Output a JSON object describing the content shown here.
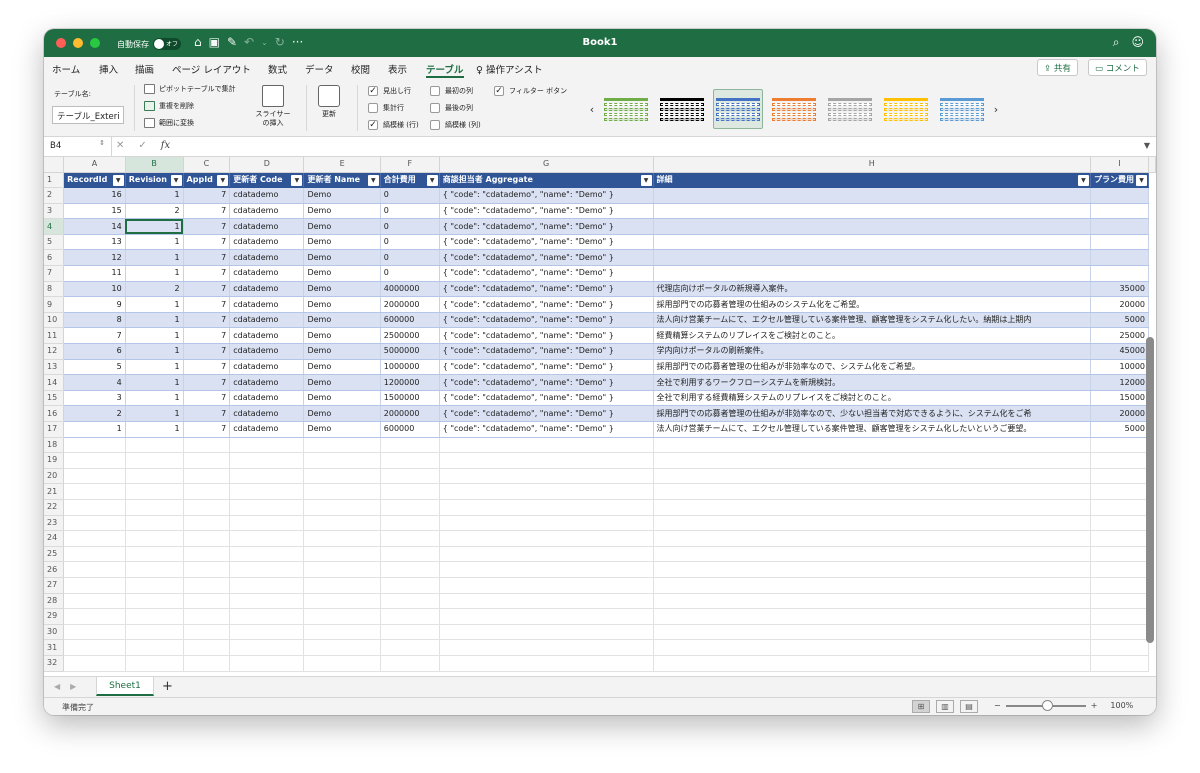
{
  "window": {
    "title": "Book1",
    "autosave_label": "自動保存",
    "autosave_state": "オフ",
    "more": "···"
  },
  "menu": {
    "tabs": [
      "ホーム",
      "挿入",
      "描画",
      "ページ レイアウト",
      "数式",
      "データ",
      "校閲",
      "表示",
      "テーブル",
      "操作アシスト"
    ],
    "active": "テーブル",
    "share": "共有",
    "comment": "コメント"
  },
  "ribbon": {
    "table_name_label": "テーブル名:",
    "table_name_value": "テーブル_Exteri",
    "pivot": "ピボットテーブルで集計",
    "dedupe": "重複を削除",
    "convert": "範囲に変換",
    "slicer": [
      "スライサー",
      "の挿入"
    ],
    "refresh": "更新",
    "header_row": "見出し行",
    "total_row": "集計行",
    "banded_rows": "縞模様 (行)",
    "first_col": "最初の列",
    "last_col": "最後の列",
    "banded_cols": "縞模様 (列)",
    "filter_btn": "フィルター ボタン",
    "style_colors": [
      "#70ad47",
      "#000000",
      "#4472c4",
      "#ed7d31",
      "#a5a5a5",
      "#ffc000",
      "#5b9bd5"
    ],
    "style_selected": 2
  },
  "formula_bar": {
    "name_box": "B4",
    "fx": "fx",
    "content": ""
  },
  "columns": [
    "A",
    "B",
    "C",
    "D",
    "E",
    "F",
    "G",
    "H",
    "I"
  ],
  "selected_col": "B",
  "selected_row": 4,
  "table_headers": [
    "RecordId",
    "Revision",
    "AppId",
    "更新者 Code",
    "更新者 Name",
    "合計費用",
    "商談担当者 Aggregate",
    "詳細",
    "プラン費用"
  ],
  "rows": [
    [
      "16",
      "1",
      "7",
      "cdatademo",
      "Demo",
      "0",
      "{   \"code\": \"cdatademo\",    \"name\": \"Demo\"  }",
      "",
      ""
    ],
    [
      "15",
      "2",
      "7",
      "cdatademo",
      "Demo",
      "0",
      "{   \"code\": \"cdatademo\",    \"name\": \"Demo\"  }",
      "",
      ""
    ],
    [
      "14",
      "1",
      "7",
      "cdatademo",
      "Demo",
      "0",
      "{   \"code\": \"cdatademo\",    \"name\": \"Demo\"  }",
      "",
      ""
    ],
    [
      "13",
      "1",
      "7",
      "cdatademo",
      "Demo",
      "0",
      "{   \"code\": \"cdatademo\",    \"name\": \"Demo\"  }",
      "",
      ""
    ],
    [
      "12",
      "1",
      "7",
      "cdatademo",
      "Demo",
      "0",
      "{   \"code\": \"cdatademo\",    \"name\": \"Demo\"  }",
      "",
      ""
    ],
    [
      "11",
      "1",
      "7",
      "cdatademo",
      "Demo",
      "0",
      "{   \"code\": \"cdatademo\",    \"name\": \"Demo\"  }",
      "",
      ""
    ],
    [
      "10",
      "2",
      "7",
      "cdatademo",
      "Demo",
      "4000000",
      "{   \"code\": \"cdatademo\",    \"name\": \"Demo\"  }",
      "代理店向けポータルの新規導入案件。",
      "35000"
    ],
    [
      "9",
      "1",
      "7",
      "cdatademo",
      "Demo",
      "2000000",
      "{   \"code\": \"cdatademo\",    \"name\": \"Demo\"  }",
      "採用部門での応募者管理の仕組みのシステム化をご希望。",
      "20000"
    ],
    [
      "8",
      "1",
      "7",
      "cdatademo",
      "Demo",
      "600000",
      "{   \"code\": \"cdatademo\",    \"name\": \"Demo\"  }",
      "法人向け営業チームにて、エクセル管理している案件管理、顧客管理をシステム化したい。納期は上期内",
      "5000"
    ],
    [
      "7",
      "1",
      "7",
      "cdatademo",
      "Demo",
      "2500000",
      "{   \"code\": \"cdatademo\",    \"name\": \"Demo\"  }",
      "経費精算システムのリプレイスをご検討とのこと。",
      "25000"
    ],
    [
      "6",
      "1",
      "7",
      "cdatademo",
      "Demo",
      "5000000",
      "{   \"code\": \"cdatademo\",    \"name\": \"Demo\"  }",
      "学内向けポータルの刷新案件。",
      "45000"
    ],
    [
      "5",
      "1",
      "7",
      "cdatademo",
      "Demo",
      "1000000",
      "{   \"code\": \"cdatademo\",    \"name\": \"Demo\"  }",
      "採用部門での応募者管理の仕組みが非効率なので、システム化をご希望。",
      "10000"
    ],
    [
      "4",
      "1",
      "7",
      "cdatademo",
      "Demo",
      "1200000",
      "{   \"code\": \"cdatademo\",    \"name\": \"Demo\"  }",
      "全社で利用するワークフローシステムを新規検討。",
      "12000"
    ],
    [
      "3",
      "1",
      "7",
      "cdatademo",
      "Demo",
      "1500000",
      "{   \"code\": \"cdatademo\",    \"name\": \"Demo\"  }",
      "全社で利用する経費精算システムのリプレイスをご検討とのこと。",
      "15000"
    ],
    [
      "2",
      "1",
      "7",
      "cdatademo",
      "Demo",
      "2000000",
      "{   \"code\": \"cdatademo\",    \"name\": \"Demo\"  }",
      "採用部門での応募者管理の仕組みが非効率なので、少ない担当者で対応できるように、システム化をご希",
      "20000"
    ],
    [
      "1",
      "1",
      "7",
      "cdatademo",
      "Demo",
      "600000",
      "{   \"code\": \"cdatademo\",    \"name\": \"Demo\"  }",
      "法人向け営業チームにて、エクセル管理している案件管理、顧客管理をシステム化したいというご要望。",
      "5000"
    ]
  ],
  "total_rows": 32,
  "sheet_tab": "Sheet1",
  "add_sheet": "+",
  "status": {
    "text": "準備完了",
    "zoom": "100%",
    "minus": "−",
    "plus": "+"
  }
}
